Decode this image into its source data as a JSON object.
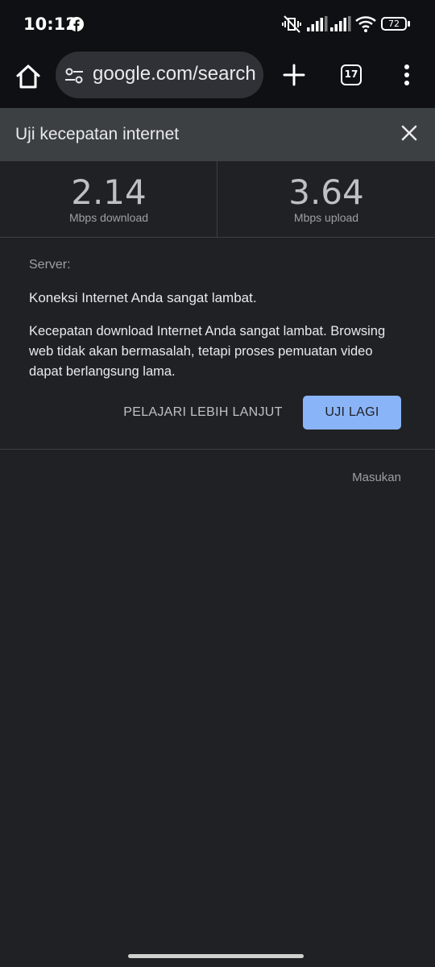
{
  "status_bar": {
    "time": "10:12",
    "battery": "72"
  },
  "toolbar": {
    "url": "google.com/search",
    "tab_count": "17"
  },
  "card": {
    "title": "Uji kecepatan internet",
    "download": {
      "value": "2.14",
      "unit": "Mbps download"
    },
    "upload": {
      "value": "3.64",
      "unit": "Mbps upload"
    },
    "server_label": "Server:",
    "headline": "Koneksi Internet Anda sangat lambat.",
    "description": "Kecepatan download Internet Anda sangat lambat. Browsing web tidak akan bermasalah, tetapi proses pemuatan video dapat berlangsung lama.",
    "learn_more_label": "PELAJARI LEBIH LANJUT",
    "retry_label": "UJI LAGI",
    "feedback_label": "Masukan"
  },
  "colors": {
    "background": "#202124",
    "accent": "#8ab4f8",
    "header": "#3c4043"
  }
}
